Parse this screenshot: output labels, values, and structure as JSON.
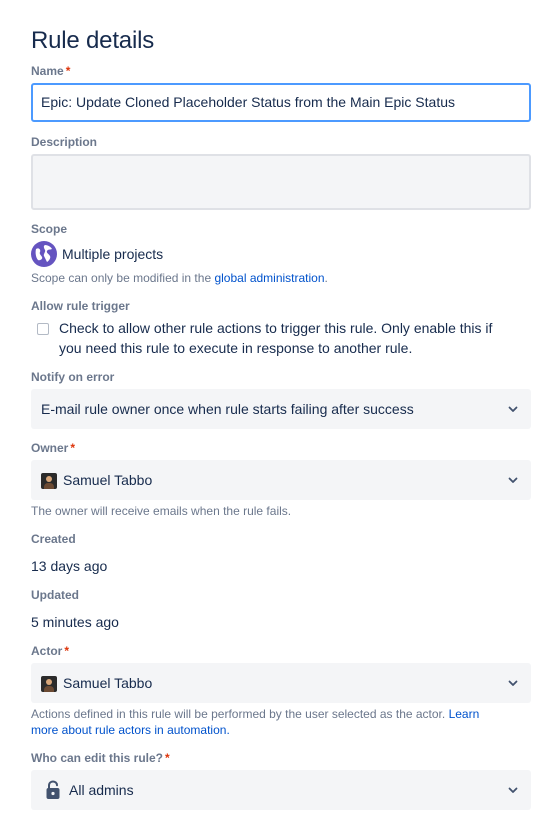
{
  "page": {
    "title": "Rule details"
  },
  "name_field": {
    "label": "Name",
    "required": "*",
    "value": "Epic: Update Cloned Placeholder Status from the Main Epic Status"
  },
  "description_field": {
    "label": "Description",
    "value": ""
  },
  "scope": {
    "label": "Scope",
    "icon": "globe-icon",
    "value": "Multiple projects",
    "help_prefix": "Scope can only be modified in the",
    "help_link": "global administration",
    "help_suffix": "."
  },
  "allow_rule_trigger": {
    "label": "Allow rule trigger",
    "checked": false,
    "text_line1": "Check to allow other rule actions to trigger this rule. Only enable this if",
    "text_line2": "you need this rule to execute in response to another rule."
  },
  "notify_on_error": {
    "label": "Notify on error",
    "value": "E-mail rule owner once when rule starts failing after success"
  },
  "owner": {
    "label": "Owner",
    "required": "*",
    "value": "Samuel Tabbo",
    "help": "The owner will receive emails when the rule fails."
  },
  "created": {
    "label": "Created",
    "value": "13 days ago"
  },
  "updated": {
    "label": "Updated",
    "value": "5 minutes ago"
  },
  "actor": {
    "label": "Actor",
    "required": "*",
    "value": "Samuel Tabbo",
    "help_line1_prefix": "Actions defined in this rule will be performed by the user selected as the actor.",
    "help_line1_link": "Learn",
    "help_line2_link": "more about rule actors in automation",
    "help_line2_suffix": "."
  },
  "who_can_edit": {
    "label": "Who can edit this rule?",
    "required": "*",
    "icon": "unlock-icon",
    "value": "All admins"
  },
  "colors": {
    "accent_link": "#0052cc",
    "required_star": "#de350b",
    "focus_border": "#4c9aff",
    "field_bg": "#f4f5f7",
    "globe": "#6554c0"
  }
}
